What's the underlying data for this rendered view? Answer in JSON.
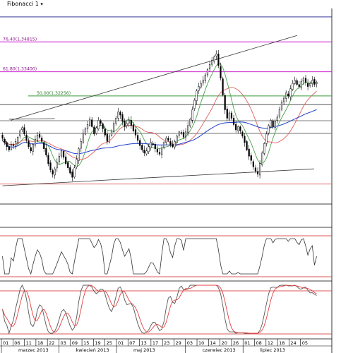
{
  "window": {
    "indicator_label": "Fibonacci 1",
    "indicator_marker": "▾"
  },
  "colors": {
    "background": "#ffffff",
    "candle_up": "#ffffff",
    "candle_down": "#000000",
    "fib_line": "#cc00cc",
    "fib_50_line": "#3a9a3a",
    "level_blue": "#1a1a8c",
    "level_gray": "#555555",
    "level_red": "#e05a5a",
    "ma_fast": "#4aa04a",
    "ma_medium": "#e06060",
    "ma_slow": "#1f3fd0",
    "channel": "#333333",
    "oscillator": "#333333",
    "stoch_k": "#555555",
    "stoch_d": "#e04040",
    "osc_level": "#d02020"
  },
  "fibonacci": [
    {
      "label": "76,40(1,34815)",
      "price": 1.34815
    },
    {
      "label": "61,80(1,33400)",
      "price": 1.334
    },
    {
      "label": "50,00(1,32256)",
      "price": 1.32256
    }
  ],
  "x_axis": {
    "days": [
      "01",
      "06",
      "11",
      "18",
      "22",
      "03",
      "09",
      "15",
      "19",
      "25",
      "01",
      "07",
      "13",
      "17",
      "23",
      "29",
      "03",
      "10",
      "14",
      "20",
      "26",
      "01",
      "08",
      "12",
      "18",
      "24",
      "05"
    ],
    "months": [
      "marzec 2013",
      "kwiecień 2013",
      "maj 2013",
      "czerwiec 2013",
      "lipiec 2013"
    ]
  },
  "chart_data": {
    "type": "candlestick",
    "price_axis": {
      "visible_range": [
        1.272,
        1.364
      ]
    },
    "horizontal_levels": [
      1.36,
      1.3184,
      1.3108,
      1.3048,
      1.2808
    ],
    "channel_upper": {
      "from": [
        0,
        1.311
      ],
      "to": [
        148,
        1.3512
      ]
    },
    "channel_lower": {
      "from": [
        0,
        1.28
      ],
      "to": [
        148,
        1.288
      ]
    },
    "close": [
      1.3025,
      1.3005,
      1.2985,
      1.297,
      1.2995,
      1.299,
      1.301,
      1.303,
      1.306,
      1.3075,
      1.3045,
      1.3015,
      1.2985,
      1.2965,
      1.2995,
      1.302,
      1.304,
      1.303,
      1.301,
      1.2975,
      1.2945,
      1.2905,
      1.2875,
      1.2855,
      1.288,
      1.291,
      1.294,
      1.2965,
      1.2935,
      1.2905,
      1.2885,
      1.286,
      1.284,
      1.2885,
      1.2925,
      1.2975,
      1.301,
      1.305,
      1.307,
      1.309,
      1.3115,
      1.308,
      1.3045,
      1.3075,
      1.311,
      1.3095,
      1.307,
      1.304,
      1.301,
      1.3035,
      1.306,
      1.3095,
      1.312,
      1.315,
      1.3135,
      1.3105,
      1.308,
      1.3095,
      1.311,
      1.3085,
      1.306,
      1.304,
      1.3015,
      1.299,
      1.297,
      1.2955,
      1.2965,
      1.2985,
      1.3005,
      1.2995,
      1.2975,
      1.296,
      1.295,
      1.298,
      1.3005,
      1.3025,
      1.3015,
      1.2995,
      1.2985,
      1.301,
      1.3035,
      1.3055,
      1.305,
      1.303,
      1.3055,
      1.3085,
      1.3115,
      1.316,
      1.3205,
      1.325,
      1.327,
      1.3285,
      1.33,
      1.3325,
      1.335,
      1.3375,
      1.3395,
      1.341,
      1.3425,
      1.337,
      1.331,
      1.323,
      1.316,
      1.312,
      1.3145,
      1.312,
      1.309,
      1.3065,
      1.308,
      1.306,
      1.3035,
      1.3005,
      1.297,
      1.294,
      1.292,
      1.289,
      1.287,
      1.2855,
      1.2905,
      1.2955,
      1.3,
      1.3045,
      1.3085,
      1.311,
      1.308,
      1.3105,
      1.3125,
      1.316,
      1.3195,
      1.3215,
      1.324,
      1.3225,
      1.326,
      1.3285,
      1.33,
      1.328,
      1.327,
      1.3295,
      1.331,
      1.329,
      1.327,
      1.3285,
      1.33,
      1.328,
      1.329
    ]
  }
}
